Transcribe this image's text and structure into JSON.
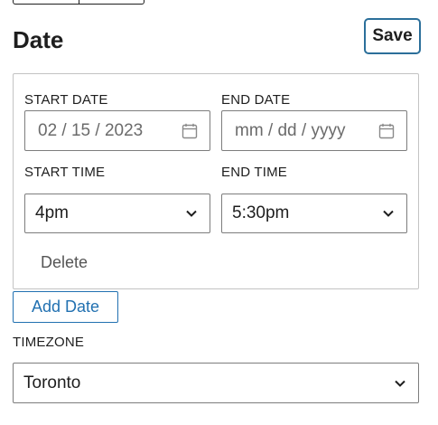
{
  "heading": "Date",
  "save_label": "Save",
  "dates": [
    {
      "start_date_label": "START DATE",
      "start_date_value": "02 / 15 / 2023",
      "end_date_label": "END DATE",
      "end_date_placeholder": "mm / dd / yyyy",
      "start_time_label": "START TIME",
      "start_time_value": "4pm",
      "end_time_label": "END TIME",
      "end_time_value": "5:30pm",
      "delete_label": "Delete"
    }
  ],
  "add_date_label": "Add Date",
  "timezone": {
    "label": "TIMEZONE",
    "value": "Toronto"
  },
  "colors": {
    "accent": "#2271b1",
    "focus_border": "#2b6f9a",
    "text": "#1e1e1e"
  },
  "icons": {
    "date_picker": "calendar-icon",
    "dropdown": "chevron-down-icon"
  }
}
